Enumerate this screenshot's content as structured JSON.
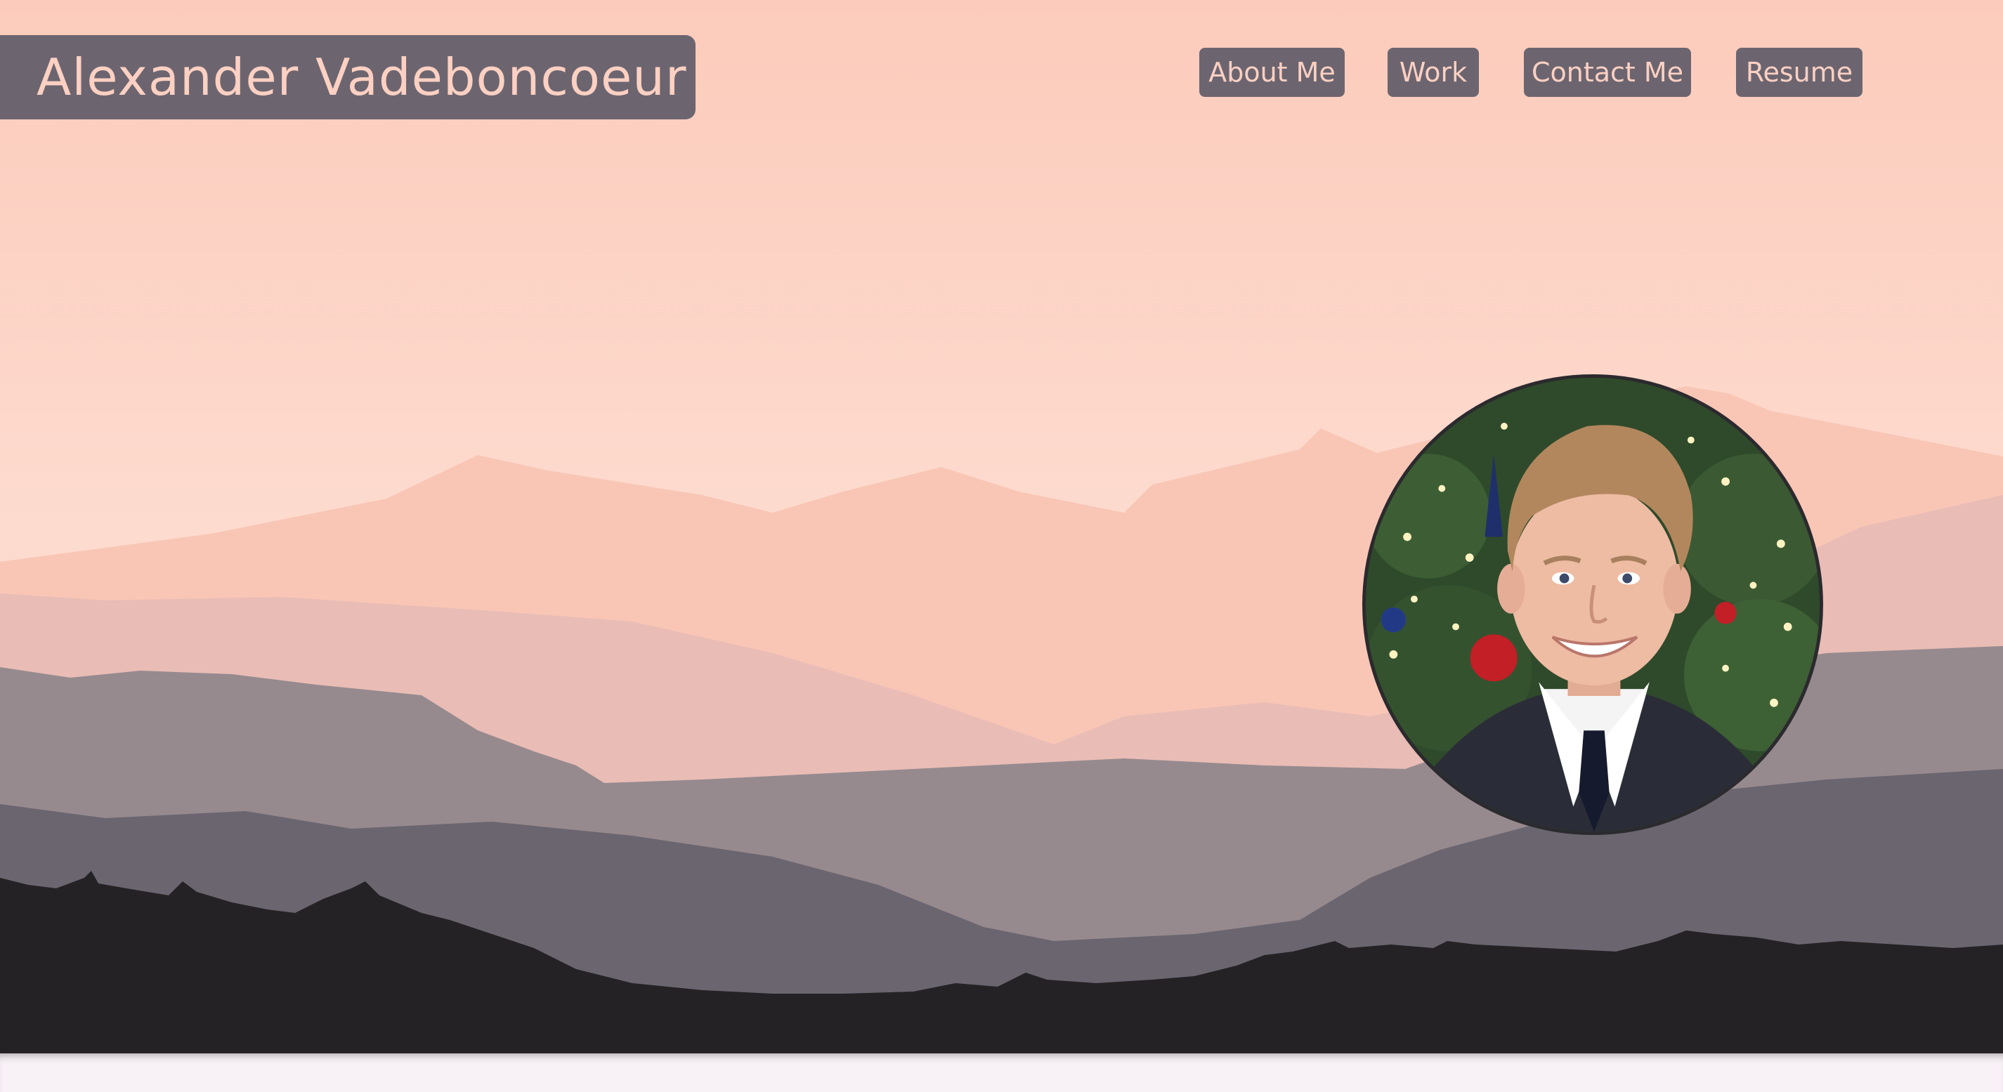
{
  "header": {
    "site_title": "Alexander Vadeboncoeur"
  },
  "nav": {
    "items": [
      {
        "label": "About Me"
      },
      {
        "label": "Work"
      },
      {
        "label": "Contact Me"
      },
      {
        "label": "Resume"
      }
    ]
  },
  "profile": {
    "photo_icon": "portrait-photo"
  },
  "colors": {
    "sky_top": "#fccbbb",
    "sky_bottom": "#fddcd0",
    "button_bg": "#6c6570",
    "button_text": "#fcd0c2",
    "page_bg": "#f8f1f6"
  }
}
